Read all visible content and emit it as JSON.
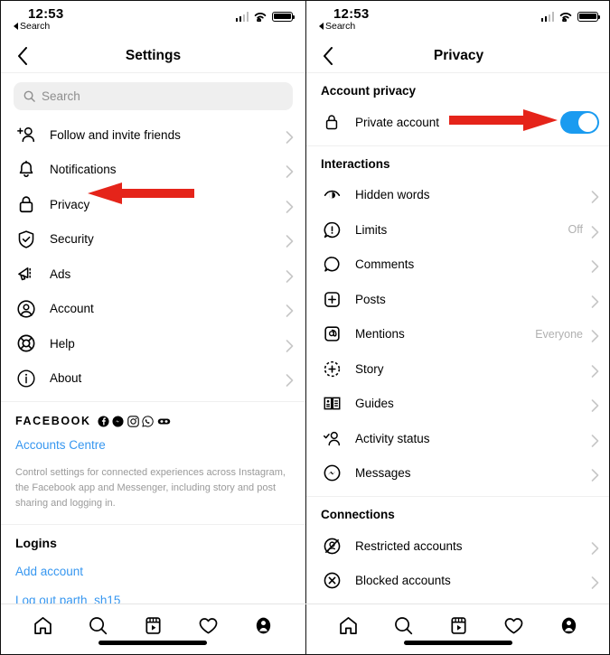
{
  "status_bar": {
    "time": "12:53",
    "back_label": "Search",
    "signal_icon": "cellular-signal-icon",
    "wifi_icon": "wifi-icon",
    "battery_icon": "battery-icon"
  },
  "left_pane": {
    "nav": {
      "back_icon": "chevron-left-icon",
      "title": "Settings"
    },
    "search": {
      "placeholder": "Search",
      "icon": "search-icon"
    },
    "menu_items": [
      {
        "label": "Follow and invite friends",
        "icon": "add-person-icon"
      },
      {
        "label": "Notifications",
        "icon": "bell-icon"
      },
      {
        "label": "Privacy",
        "icon": "lock-icon"
      },
      {
        "label": "Security",
        "icon": "shield-check-icon"
      },
      {
        "label": "Ads",
        "icon": "megaphone-icon"
      },
      {
        "label": "Account",
        "icon": "person-circle-icon"
      },
      {
        "label": "Help",
        "icon": "lifebuoy-icon"
      },
      {
        "label": "About",
        "icon": "info-circle-icon"
      }
    ],
    "facebook": {
      "word": "FACEBOOK",
      "app_icons": [
        "facebook-icon",
        "messenger-icon",
        "instagram-icon",
        "whatsapp-icon",
        "oculus-icon"
      ],
      "accounts_centre_link": "Accounts Centre",
      "description": "Control settings for connected experiences across Instagram, the Facebook app and Messenger, including story and post sharing and logging in."
    },
    "logins": {
      "title": "Logins",
      "add_account_link": "Add account",
      "log_out_link": "Log out parth_sh15"
    }
  },
  "right_pane": {
    "nav": {
      "back_icon": "chevron-left-icon",
      "title": "Privacy"
    },
    "sections": [
      {
        "title": "Account privacy",
        "items": [
          {
            "label": "Private account",
            "icon": "lock-icon",
            "control": "toggle",
            "toggle_on": true
          }
        ]
      },
      {
        "title": "Interactions",
        "items": [
          {
            "label": "Hidden words",
            "icon": "hidden-words-icon",
            "value": ""
          },
          {
            "label": "Limits",
            "icon": "limits-icon",
            "value": "Off"
          },
          {
            "label": "Comments",
            "icon": "comment-icon",
            "value": ""
          },
          {
            "label": "Posts",
            "icon": "posts-plus-icon",
            "value": ""
          },
          {
            "label": "Mentions",
            "icon": "at-mention-icon",
            "value": "Everyone"
          },
          {
            "label": "Story",
            "icon": "story-plus-icon",
            "value": ""
          },
          {
            "label": "Guides",
            "icon": "guides-book-icon",
            "value": ""
          },
          {
            "label": "Activity status",
            "icon": "activity-status-icon",
            "value": ""
          },
          {
            "label": "Messages",
            "icon": "messenger-icon",
            "value": ""
          }
        ]
      },
      {
        "title": "Connections",
        "items": [
          {
            "label": "Restricted accounts",
            "icon": "restricted-icon",
            "value": ""
          },
          {
            "label": "Blocked accounts",
            "icon": "blocked-x-icon",
            "value": ""
          }
        ]
      }
    ]
  },
  "tab_bar": {
    "items": [
      {
        "icon": "home-icon",
        "label": "Home"
      },
      {
        "icon": "search-icon",
        "label": "Search"
      },
      {
        "icon": "reels-icon",
        "label": "Reels"
      },
      {
        "icon": "heart-icon",
        "label": "Activity"
      },
      {
        "icon": "profile-icon",
        "label": "Profile"
      }
    ]
  },
  "annotations": {
    "left_arrow": {
      "name": "red-arrow-pointing-to-privacy",
      "direction": "left",
      "color": "#e5241a"
    },
    "right_arrow": {
      "name": "red-arrow-pointing-to-private-account-toggle",
      "direction": "right",
      "color": "#e5241a"
    }
  },
  "colors": {
    "link": "#3797f0",
    "toggle_on": "#1a9bf0",
    "arrow_red": "#e5241a",
    "muted": "#b0b0b0"
  }
}
